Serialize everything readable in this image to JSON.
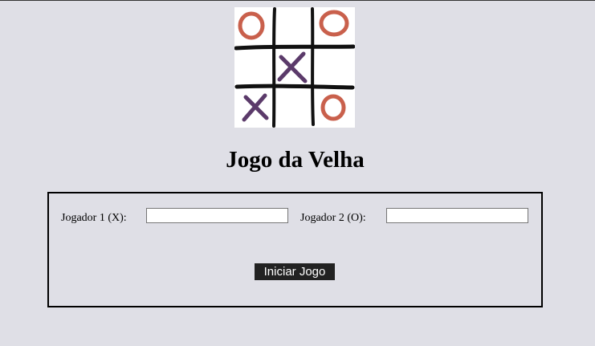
{
  "logo": {
    "icon": "tic-tac-toe-board-icon",
    "colors": {
      "grid": "#111111",
      "o_mark": "#c9604c",
      "x_mark": "#5b3a6a"
    }
  },
  "title": "Jogo da Velha",
  "form": {
    "player1_label": "Jogador 1 (X):",
    "player1_value": "",
    "player2_label": "Jogador 2 (O):",
    "player2_value": "",
    "start_button_label": "Iniciar Jogo"
  }
}
